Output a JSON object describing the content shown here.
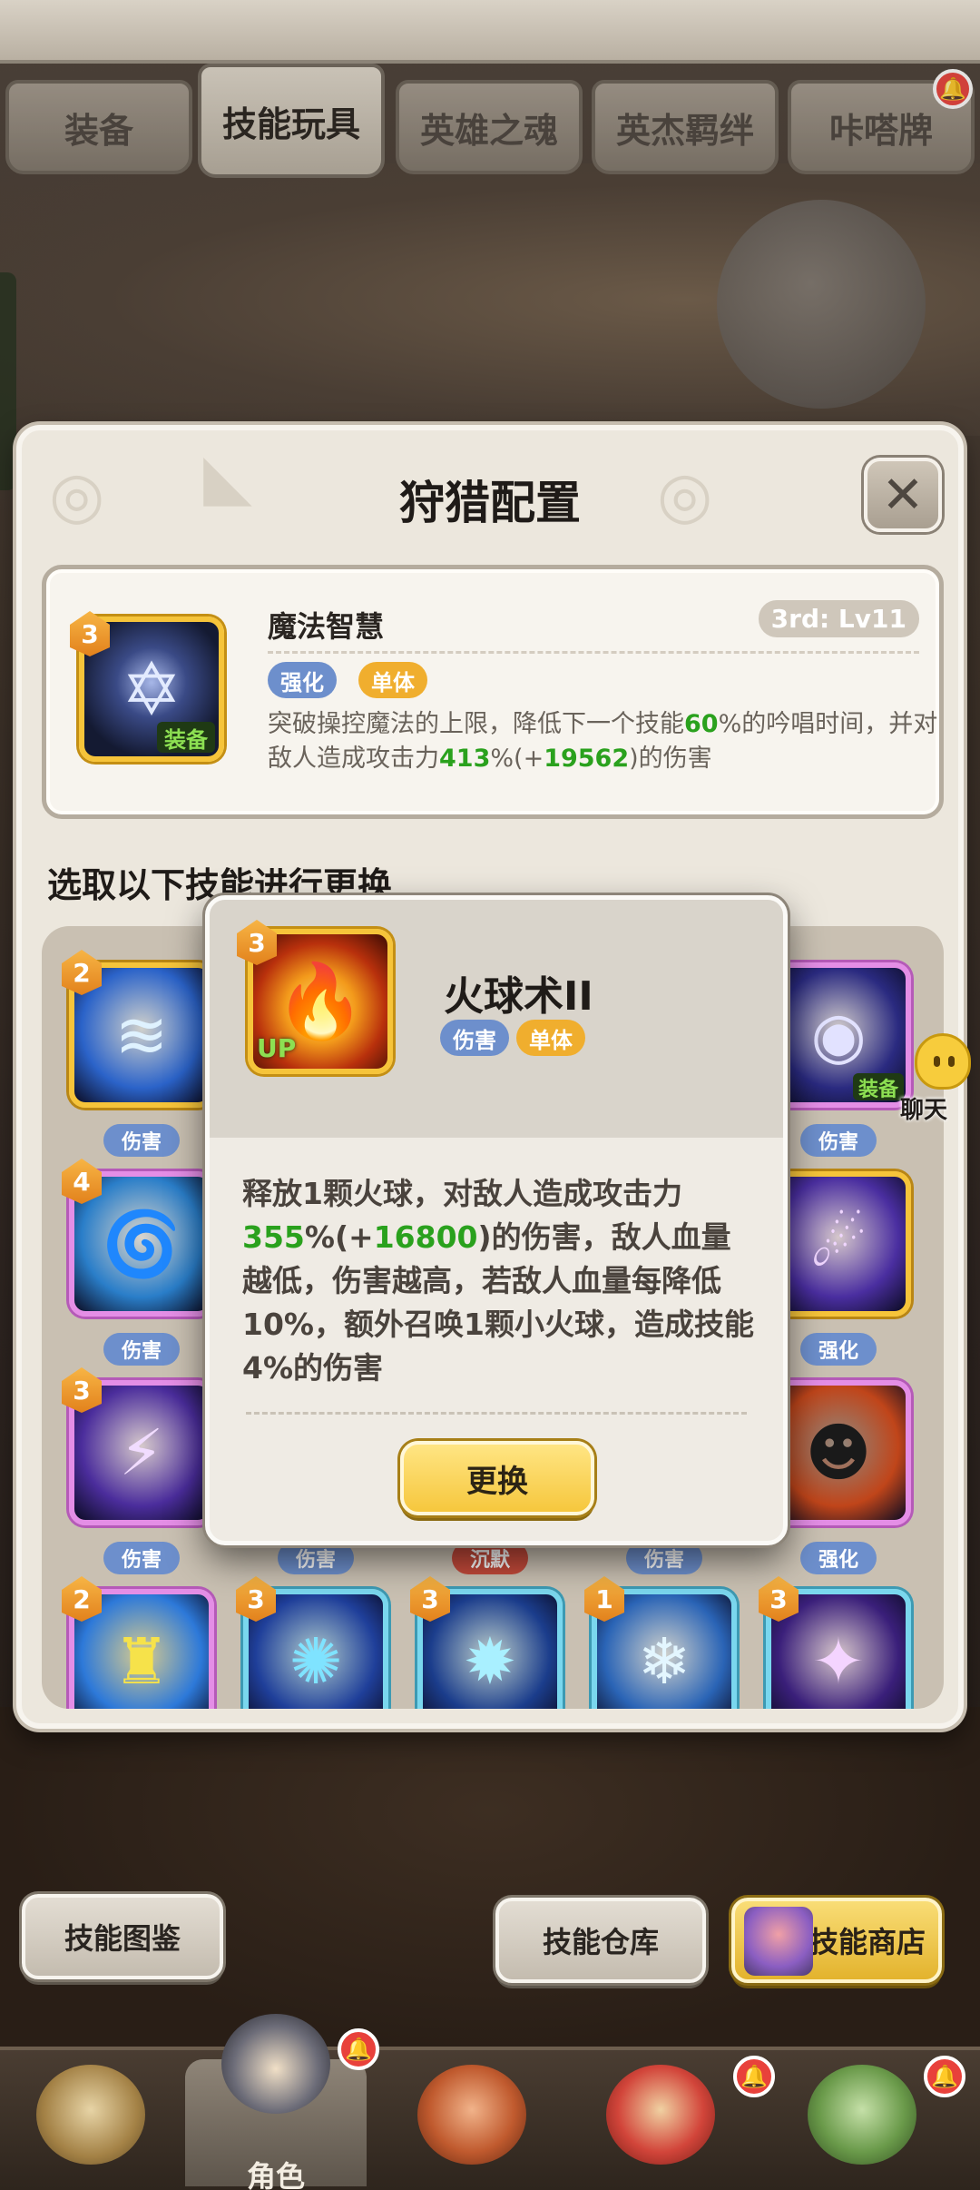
{
  "tabs": [
    {
      "label": "装备",
      "active": false
    },
    {
      "label": "技能玩具",
      "active": true
    },
    {
      "label": "英雄之魂",
      "active": false
    },
    {
      "label": "英杰羁绊",
      "active": false
    },
    {
      "label": "咔嗒牌",
      "active": false
    }
  ],
  "panel": {
    "title": "狩猎配置",
    "close_glyph": "✕"
  },
  "equipped": {
    "name": "魔法智慧",
    "level_badge": "3",
    "level_text": "3rd: Lv11",
    "equip_tag": "装备",
    "tags": [
      "强化",
      "单体"
    ],
    "desc_parts": {
      "p1": "突破操控魔法的上限，降低下一个技能",
      "v1": "60",
      "p2": "%的吟唱时间，并对敌人造成攻击力",
      "v2": "413",
      "p3": "%(+",
      "v3": "19562",
      "p4": ")的伤害"
    }
  },
  "section_label": "选取以下技能进行更换",
  "grid": [
    {
      "row": 0,
      "col": 0,
      "level": "2",
      "tag": "伤害",
      "frame": "gold",
      "glyph": "≋",
      "bg": "#2b63c9",
      "fg": "#dff2ff"
    },
    {
      "row": 0,
      "col": 4,
      "level": "",
      "tag": "伤害",
      "frame": "pink",
      "glyph": "◉",
      "bg": "#2a2a80",
      "fg": "#e2e2ff",
      "equip": "装备"
    },
    {
      "row": 1,
      "col": 0,
      "level": "4",
      "tag": "伤害",
      "frame": "pink",
      "glyph": "🌀",
      "bg": "#2a7ec9",
      "fg": "#ffffff"
    },
    {
      "row": 1,
      "col": 4,
      "level": "",
      "tag": "强化",
      "frame": "gold",
      "glyph": "☄",
      "bg": "#4a2ea0",
      "fg": "#f0d6ff"
    },
    {
      "row": 2,
      "col": 0,
      "level": "3",
      "tag": "伤害",
      "frame": "pink",
      "glyph": "⚡",
      "bg": "#4b2d9c",
      "fg": "#f1dcff"
    },
    {
      "row": 2,
      "col": 1,
      "level": "",
      "tag": "伤害",
      "frame": "pink",
      "glyph": "",
      "bg": "#c9c0b2",
      "fg": "#ffffff"
    },
    {
      "row": 2,
      "col": 2,
      "level": "",
      "tag": "沉默",
      "tag_red": true,
      "frame": "pink",
      "glyph": "",
      "bg": "#c9c0b2",
      "fg": "#ffffff"
    },
    {
      "row": 2,
      "col": 3,
      "level": "",
      "tag": "伤害",
      "frame": "pink",
      "glyph": "",
      "bg": "#c9c0b2",
      "fg": "#ffffff"
    },
    {
      "row": 2,
      "col": 4,
      "level": "",
      "tag": "强化",
      "frame": "pink",
      "glyph": "☻",
      "bg": "#c0451a",
      "fg": "#1a1a1a"
    },
    {
      "row": 3,
      "col": 0,
      "level": "2",
      "tag": "",
      "frame": "pink",
      "glyph": "♜",
      "bg": "#2d79d9",
      "fg": "#f6e24a"
    },
    {
      "row": 3,
      "col": 1,
      "level": "3",
      "tag": "",
      "frame": "cyan",
      "glyph": "✺",
      "bg": "#1f3f9a",
      "fg": "#7fe3ff"
    },
    {
      "row": 3,
      "col": 2,
      "level": "3",
      "tag": "",
      "frame": "cyan",
      "glyph": "✹",
      "bg": "#1b3d8c",
      "fg": "#a9f0ff"
    },
    {
      "row": 3,
      "col": 3,
      "level": "1",
      "tag": "",
      "frame": "cyan",
      "glyph": "❄",
      "bg": "#2a64b6",
      "fg": "#e3f6ff"
    },
    {
      "row": 3,
      "col": 4,
      "level": "3",
      "tag": "",
      "frame": "cyan",
      "glyph": "✦",
      "bg": "#3a1f7a",
      "fg": "#f4d4ff"
    }
  ],
  "popup": {
    "name": "火球术II",
    "level": "3",
    "up_tag": "UP",
    "tags": [
      "伤害",
      "单体"
    ],
    "desc_parts": {
      "p1": "释放1颗火球，对敌人造成攻击力",
      "v1": "355",
      "p2": "%(+",
      "v2": "16800",
      "p3": ")的伤害，敌人血量越低，伤害越高，若敌人血量每降低10%，额外召唤1颗小火球，造成技能4%的伤害"
    },
    "button": "更换"
  },
  "chat": {
    "label": "聊天"
  },
  "bottom_buttons": {
    "codex": "技能图鉴",
    "warehouse": "技能仓库",
    "shop": "技能商店"
  },
  "nav": {
    "items": [
      {
        "label": "",
        "badge": false
      },
      {
        "label": "角色",
        "badge": true
      },
      {
        "label": "",
        "badge": false
      },
      {
        "label": "",
        "badge": true
      },
      {
        "label": "",
        "badge": true
      }
    ],
    "badge_glyph": "🔔"
  },
  "colors": {
    "highlight_green": "#2aa11d",
    "tag_blue": "#6d8fcc",
    "tag_gold": "#f0ae2e",
    "tag_red": "#c44a3a",
    "button_gold": "#f6c73d"
  }
}
